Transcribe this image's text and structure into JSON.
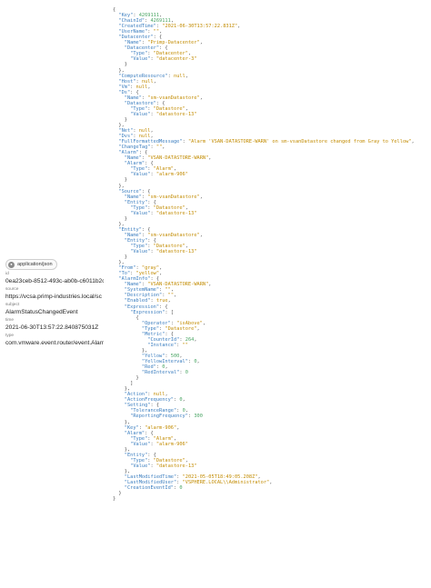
{
  "sidebar": {
    "content_type": "application/json",
    "fields": [
      {
        "label": "id",
        "value": "0ea23ceb-8512-493c-ab0b-c6011b2c"
      },
      {
        "label": "source",
        "value": "https://vcsa.primp-industries.local/sc"
      },
      {
        "label": "subject",
        "value": "AlarmStatusChangedEvent"
      },
      {
        "label": "time",
        "value": "2021-06-30T13:57:22.840875031Z"
      },
      {
        "label": "type",
        "value": "com.vmware.event.router/event.Alarm"
      }
    ]
  },
  "json_lines": [
    [
      0,
      [
        [
          "p",
          "{"
        ]
      ]
    ],
    [
      1,
      [
        [
          "k",
          "\"Key\""
        ],
        [
          "p",
          ": "
        ],
        [
          "n",
          "4269111"
        ],
        [
          "p",
          ","
        ]
      ]
    ],
    [
      1,
      [
        [
          "k",
          "\"ChainId\""
        ],
        [
          "p",
          ": "
        ],
        [
          "n",
          "4269111"
        ],
        [
          "p",
          ","
        ]
      ]
    ],
    [
      1,
      [
        [
          "k",
          "\"CreatedTime\""
        ],
        [
          "p",
          ": "
        ],
        [
          "s",
          "\"2021-06-30T13:57:22.831Z\""
        ],
        [
          "p",
          ","
        ]
      ]
    ],
    [
      1,
      [
        [
          "k",
          "\"UserName\""
        ],
        [
          "p",
          ": "
        ],
        [
          "s",
          "\"\""
        ],
        [
          "p",
          ","
        ]
      ]
    ],
    [
      1,
      [
        [
          "k",
          "\"Datacenter\""
        ],
        [
          "p",
          ": {"
        ]
      ]
    ],
    [
      2,
      [
        [
          "k",
          "\"Name\""
        ],
        [
          "p",
          ": "
        ],
        [
          "s",
          "\"Primp-Datacenter\""
        ],
        [
          "p",
          ","
        ]
      ]
    ],
    [
      2,
      [
        [
          "k",
          "\"Datacenter\""
        ],
        [
          "p",
          ": {"
        ]
      ]
    ],
    [
      3,
      [
        [
          "k",
          "\"Type\""
        ],
        [
          "p",
          ": "
        ],
        [
          "s",
          "\"Datacenter\""
        ],
        [
          "p",
          ","
        ]
      ]
    ],
    [
      3,
      [
        [
          "k",
          "\"Value\""
        ],
        [
          "p",
          ": "
        ],
        [
          "s",
          "\"datacenter-3\""
        ]
      ]
    ],
    [
      2,
      [
        [
          "p",
          "}"
        ]
      ]
    ],
    [
      1,
      [
        [
          "p",
          "},"
        ]
      ]
    ],
    [
      1,
      [
        [
          "k",
          "\"ComputeResource\""
        ],
        [
          "p",
          ": "
        ],
        [
          "l",
          "null"
        ],
        [
          "p",
          ","
        ]
      ]
    ],
    [
      1,
      [
        [
          "k",
          "\"Host\""
        ],
        [
          "p",
          ": "
        ],
        [
          "l",
          "null"
        ],
        [
          "p",
          ","
        ]
      ]
    ],
    [
      1,
      [
        [
          "k",
          "\"Vm\""
        ],
        [
          "p",
          ": "
        ],
        [
          "l",
          "null"
        ],
        [
          "p",
          ","
        ]
      ]
    ],
    [
      1,
      [
        [
          "k",
          "\"Ds\""
        ],
        [
          "p",
          ": {"
        ]
      ]
    ],
    [
      2,
      [
        [
          "k",
          "\"Name\""
        ],
        [
          "p",
          ": "
        ],
        [
          "s",
          "\"sm-vsanDatastore\""
        ],
        [
          "p",
          ","
        ]
      ]
    ],
    [
      2,
      [
        [
          "k",
          "\"Datastore\""
        ],
        [
          "p",
          ": {"
        ]
      ]
    ],
    [
      3,
      [
        [
          "k",
          "\"Type\""
        ],
        [
          "p",
          ": "
        ],
        [
          "s",
          "\"Datastore\""
        ],
        [
          "p",
          ","
        ]
      ]
    ],
    [
      3,
      [
        [
          "k",
          "\"Value\""
        ],
        [
          "p",
          ": "
        ],
        [
          "s",
          "\"datastore-13\""
        ]
      ]
    ],
    [
      2,
      [
        [
          "p",
          "}"
        ]
      ]
    ],
    [
      1,
      [
        [
          "p",
          "},"
        ]
      ]
    ],
    [
      1,
      [
        [
          "k",
          "\"Net\""
        ],
        [
          "p",
          ": "
        ],
        [
          "l",
          "null"
        ],
        [
          "p",
          ","
        ]
      ]
    ],
    [
      1,
      [
        [
          "k",
          "\"Dvs\""
        ],
        [
          "p",
          ": "
        ],
        [
          "l",
          "null"
        ],
        [
          "p",
          ","
        ]
      ]
    ],
    [
      1,
      [
        [
          "k",
          "\"FullFormattedMessage\""
        ],
        [
          "p",
          ": "
        ],
        [
          "s",
          "\"Alarm 'VSAN-DATASTORE-WARN' on sm-vsanDatastore changed from Gray to Yellow\""
        ],
        [
          "p",
          ","
        ]
      ]
    ],
    [
      1,
      [
        [
          "k",
          "\"ChangeTag\""
        ],
        [
          "p",
          ": "
        ],
        [
          "s",
          "\"\""
        ],
        [
          "p",
          ","
        ]
      ]
    ],
    [
      1,
      [
        [
          "k",
          "\"Alarm\""
        ],
        [
          "p",
          ": {"
        ]
      ]
    ],
    [
      2,
      [
        [
          "k",
          "\"Name\""
        ],
        [
          "p",
          ": "
        ],
        [
          "s",
          "\"VSAN-DATASTORE-WARN\""
        ],
        [
          "p",
          ","
        ]
      ]
    ],
    [
      2,
      [
        [
          "k",
          "\"Alarm\""
        ],
        [
          "p",
          ": {"
        ]
      ]
    ],
    [
      3,
      [
        [
          "k",
          "\"Type\""
        ],
        [
          "p",
          ": "
        ],
        [
          "s",
          "\"Alarm\""
        ],
        [
          "p",
          ","
        ]
      ]
    ],
    [
      3,
      [
        [
          "k",
          "\"Value\""
        ],
        [
          "p",
          ": "
        ],
        [
          "s",
          "\"alarm-906\""
        ]
      ]
    ],
    [
      2,
      [
        [
          "p",
          "}"
        ]
      ]
    ],
    [
      1,
      [
        [
          "p",
          "},"
        ]
      ]
    ],
    [
      1,
      [
        [
          "k",
          "\"Source\""
        ],
        [
          "p",
          ": {"
        ]
      ]
    ],
    [
      2,
      [
        [
          "k",
          "\"Name\""
        ],
        [
          "p",
          ": "
        ],
        [
          "s",
          "\"sm-vsanDatastore\""
        ],
        [
          "p",
          ","
        ]
      ]
    ],
    [
      2,
      [
        [
          "k",
          "\"Entity\""
        ],
        [
          "p",
          ": {"
        ]
      ]
    ],
    [
      3,
      [
        [
          "k",
          "\"Type\""
        ],
        [
          "p",
          ": "
        ],
        [
          "s",
          "\"Datastore\""
        ],
        [
          "p",
          ","
        ]
      ]
    ],
    [
      3,
      [
        [
          "k",
          "\"Value\""
        ],
        [
          "p",
          ": "
        ],
        [
          "s",
          "\"datastore-13\""
        ]
      ]
    ],
    [
      2,
      [
        [
          "p",
          "}"
        ]
      ]
    ],
    [
      1,
      [
        [
          "p",
          "},"
        ]
      ]
    ],
    [
      1,
      [
        [
          "k",
          "\"Entity\""
        ],
        [
          "p",
          ": {"
        ]
      ]
    ],
    [
      2,
      [
        [
          "k",
          "\"Name\""
        ],
        [
          "p",
          ": "
        ],
        [
          "s",
          "\"sm-vsanDatastore\""
        ],
        [
          "p",
          ","
        ]
      ]
    ],
    [
      2,
      [
        [
          "k",
          "\"Entity\""
        ],
        [
          "p",
          ": {"
        ]
      ]
    ],
    [
      3,
      [
        [
          "k",
          "\"Type\""
        ],
        [
          "p",
          ": "
        ],
        [
          "s",
          "\"Datastore\""
        ],
        [
          "p",
          ","
        ]
      ]
    ],
    [
      3,
      [
        [
          "k",
          "\"Value\""
        ],
        [
          "p",
          ": "
        ],
        [
          "s",
          "\"datastore-13\""
        ]
      ]
    ],
    [
      2,
      [
        [
          "p",
          "}"
        ]
      ]
    ],
    [
      1,
      [
        [
          "p",
          "},"
        ]
      ]
    ],
    [
      1,
      [
        [
          "k",
          "\"From\""
        ],
        [
          "p",
          ": "
        ],
        [
          "s",
          "\"gray\""
        ],
        [
          "p",
          ","
        ]
      ]
    ],
    [
      1,
      [
        [
          "k",
          "\"To\""
        ],
        [
          "p",
          ": "
        ],
        [
          "s",
          "\"yellow\""
        ],
        [
          "p",
          ","
        ]
      ]
    ],
    [
      1,
      [
        [
          "k",
          "\"AlarmInfo\""
        ],
        [
          "p",
          ": {"
        ]
      ]
    ],
    [
      2,
      [
        [
          "k",
          "\"Name\""
        ],
        [
          "p",
          ": "
        ],
        [
          "s",
          "\"VSAN-DATASTORE-WARN\""
        ],
        [
          "p",
          ","
        ]
      ]
    ],
    [
      2,
      [
        [
          "k",
          "\"SystemName\""
        ],
        [
          "p",
          ": "
        ],
        [
          "s",
          "\"\""
        ],
        [
          "p",
          ","
        ]
      ]
    ],
    [
      2,
      [
        [
          "k",
          "\"Description\""
        ],
        [
          "p",
          ": "
        ],
        [
          "s",
          "\"\""
        ],
        [
          "p",
          ","
        ]
      ]
    ],
    [
      2,
      [
        [
          "k",
          "\"Enabled\""
        ],
        [
          "p",
          ": "
        ],
        [
          "l",
          "true"
        ],
        [
          "p",
          ","
        ]
      ]
    ],
    [
      2,
      [
        [
          "k",
          "\"Expression\""
        ],
        [
          "p",
          ": {"
        ]
      ]
    ],
    [
      3,
      [
        [
          "k",
          "\"Expression\""
        ],
        [
          "p",
          ": ["
        ]
      ]
    ],
    [
      4,
      [
        [
          "p",
          "{"
        ]
      ]
    ],
    [
      5,
      [
        [
          "k",
          "\"Operator\""
        ],
        [
          "p",
          ": "
        ],
        [
          "s",
          "\"isAbove\""
        ],
        [
          "p",
          ","
        ]
      ]
    ],
    [
      5,
      [
        [
          "k",
          "\"Type\""
        ],
        [
          "p",
          ": "
        ],
        [
          "s",
          "\"Datastore\""
        ],
        [
          "p",
          ","
        ]
      ]
    ],
    [
      5,
      [
        [
          "k",
          "\"Metric\""
        ],
        [
          "p",
          ": {"
        ]
      ]
    ],
    [
      6,
      [
        [
          "k",
          "\"CounterId\""
        ],
        [
          "p",
          ": "
        ],
        [
          "n",
          "264"
        ],
        [
          "p",
          ","
        ]
      ]
    ],
    [
      6,
      [
        [
          "k",
          "\"Instance\""
        ],
        [
          "p",
          ": "
        ],
        [
          "s",
          "\"\""
        ]
      ]
    ],
    [
      5,
      [
        [
          "p",
          "},"
        ]
      ]
    ],
    [
      5,
      [
        [
          "k",
          "\"Yellow\""
        ],
        [
          "p",
          ": "
        ],
        [
          "n",
          "500"
        ],
        [
          "p",
          ","
        ]
      ]
    ],
    [
      5,
      [
        [
          "k",
          "\"YellowInterval\""
        ],
        [
          "p",
          ": "
        ],
        [
          "n",
          "0"
        ],
        [
          "p",
          ","
        ]
      ]
    ],
    [
      5,
      [
        [
          "k",
          "\"Red\""
        ],
        [
          "p",
          ": "
        ],
        [
          "n",
          "0"
        ],
        [
          "p",
          ","
        ]
      ]
    ],
    [
      5,
      [
        [
          "k",
          "\"RedInterval\""
        ],
        [
          "p",
          ": "
        ],
        [
          "n",
          "0"
        ]
      ]
    ],
    [
      4,
      [
        [
          "p",
          "}"
        ]
      ]
    ],
    [
      3,
      [
        [
          "p",
          "]"
        ]
      ]
    ],
    [
      2,
      [
        [
          "p",
          "},"
        ]
      ]
    ],
    [
      2,
      [
        [
          "k",
          "\"Action\""
        ],
        [
          "p",
          ": "
        ],
        [
          "l",
          "null"
        ],
        [
          "p",
          ","
        ]
      ]
    ],
    [
      2,
      [
        [
          "k",
          "\"ActionFrequency\""
        ],
        [
          "p",
          ": "
        ],
        [
          "n",
          "0"
        ],
        [
          "p",
          ","
        ]
      ]
    ],
    [
      2,
      [
        [
          "k",
          "\"Setting\""
        ],
        [
          "p",
          ": {"
        ]
      ]
    ],
    [
      3,
      [
        [
          "k",
          "\"ToleranceRange\""
        ],
        [
          "p",
          ": "
        ],
        [
          "n",
          "0"
        ],
        [
          "p",
          ","
        ]
      ]
    ],
    [
      3,
      [
        [
          "k",
          "\"ReportingFrequency\""
        ],
        [
          "p",
          ": "
        ],
        [
          "n",
          "300"
        ]
      ]
    ],
    [
      2,
      [
        [
          "p",
          "},"
        ]
      ]
    ],
    [
      2,
      [
        [
          "k",
          "\"Key\""
        ],
        [
          "p",
          ": "
        ],
        [
          "s",
          "\"alarm-906\""
        ],
        [
          "p",
          ","
        ]
      ]
    ],
    [
      2,
      [
        [
          "k",
          "\"Alarm\""
        ],
        [
          "p",
          ": {"
        ]
      ]
    ],
    [
      3,
      [
        [
          "k",
          "\"Type\""
        ],
        [
          "p",
          ": "
        ],
        [
          "s",
          "\"Alarm\""
        ],
        [
          "p",
          ","
        ]
      ]
    ],
    [
      3,
      [
        [
          "k",
          "\"Value\""
        ],
        [
          "p",
          ": "
        ],
        [
          "s",
          "\"alarm-906\""
        ]
      ]
    ],
    [
      2,
      [
        [
          "p",
          "},"
        ]
      ]
    ],
    [
      2,
      [
        [
          "k",
          "\"Entity\""
        ],
        [
          "p",
          ": {"
        ]
      ]
    ],
    [
      3,
      [
        [
          "k",
          "\"Type\""
        ],
        [
          "p",
          ": "
        ],
        [
          "s",
          "\"Datastore\""
        ],
        [
          "p",
          ","
        ]
      ]
    ],
    [
      3,
      [
        [
          "k",
          "\"Value\""
        ],
        [
          "p",
          ": "
        ],
        [
          "s",
          "\"datastore-13\""
        ]
      ]
    ],
    [
      2,
      [
        [
          "p",
          "},"
        ]
      ]
    ],
    [
      2,
      [
        [
          "k",
          "\"LastModifiedTime\""
        ],
        [
          "p",
          ": "
        ],
        [
          "s",
          "\"2021-05-05T18:49:05.208Z\""
        ],
        [
          "p",
          ","
        ]
      ]
    ],
    [
      2,
      [
        [
          "k",
          "\"LastModifiedUser\""
        ],
        [
          "p",
          ": "
        ],
        [
          "s",
          "\"VSPHERE.LOCAL\\\\Administrator\""
        ],
        [
          "p",
          ","
        ]
      ]
    ],
    [
      2,
      [
        [
          "k",
          "\"CreationEventId\""
        ],
        [
          "p",
          ": "
        ],
        [
          "n",
          "0"
        ]
      ]
    ],
    [
      1,
      [
        [
          "p",
          "}"
        ]
      ]
    ],
    [
      0,
      [
        [
          "p",
          "}"
        ]
      ]
    ]
  ],
  "colors": {
    "key": "#3a7dbf",
    "string": "#c28b00",
    "number": "#4aa564",
    "literal": "#c28b00",
    "punctuation": "#555555"
  }
}
